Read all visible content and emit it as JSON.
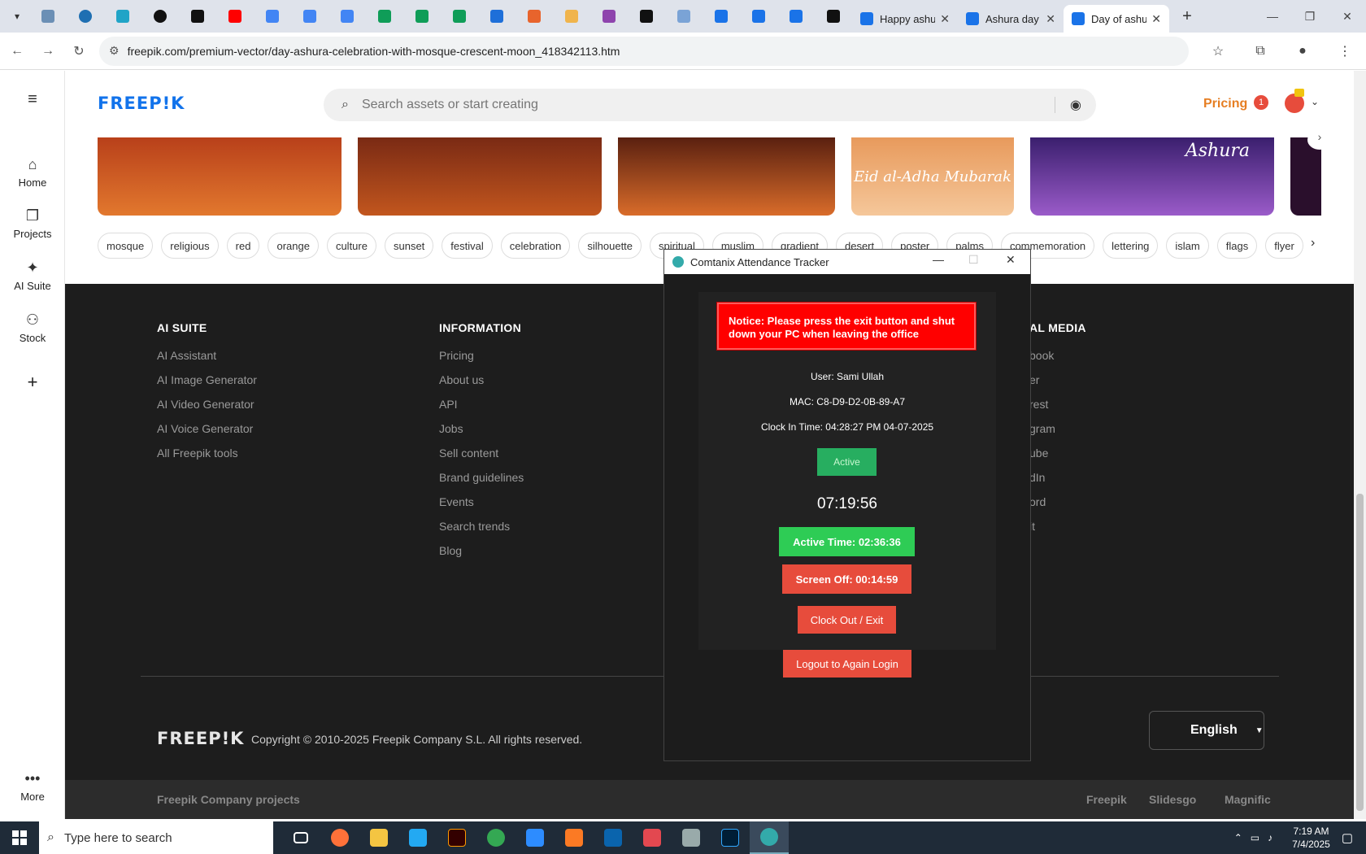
{
  "browser": {
    "tabs": [
      {
        "title": "Happy ashu"
      },
      {
        "title": "Ashura day"
      },
      {
        "title": "Day of ashu"
      }
    ],
    "url": "freepik.com/premium-vector/day-ashura-celebration-with-mosque-crescent-moon_418342113.htm"
  },
  "sidebar": {
    "items": [
      {
        "label": "Home"
      },
      {
        "label": "Projects"
      },
      {
        "label": "AI Suite"
      },
      {
        "label": "Stock"
      }
    ],
    "more_label": "More"
  },
  "header": {
    "logo": "FREEP!K",
    "search_placeholder": "Search assets or start creating",
    "pricing": "Pricing",
    "notification_count": "1"
  },
  "thumbnails": [
    {
      "colors": [
        "#b8401a",
        "#e2782e"
      ]
    },
    {
      "colors": [
        "#7a2a14",
        "#c2561e"
      ]
    },
    {
      "colors": [
        "#5a2010",
        "#d96c2a"
      ],
      "text": ""
    },
    {
      "colors": [
        "#e89a5c",
        "#f5c79a"
      ],
      "text": "Eid al-Adha Mubarak"
    },
    {
      "colors": [
        "#3a1f6e",
        "#9a5bc9"
      ],
      "text": "Ashura"
    }
  ],
  "tags": [
    "mosque",
    "religious",
    "red",
    "orange",
    "culture",
    "sunset",
    "festival",
    "celebration",
    "silhouette",
    "spiritual",
    "muslim",
    "gradient",
    "desert",
    "poster",
    "palms",
    "commemoration",
    "lettering",
    "islam",
    "flags",
    "flyer"
  ],
  "footer": {
    "columns": [
      {
        "title": "AI SUITE",
        "links": [
          "AI Assistant",
          "AI Image Generator",
          "AI Video Generator",
          "AI Voice Generator",
          "All Freepik tools"
        ]
      },
      {
        "title": "INFORMATION",
        "links": [
          "Pricing",
          "About us",
          "API",
          "Jobs",
          "Sell content",
          "Brand guidelines",
          "Events",
          "Search trends",
          "Blog"
        ]
      },
      {
        "title": "AL MEDIA",
        "links": [
          "book",
          "er",
          "rest",
          "gram",
          "ube",
          "dIn",
          "ord",
          "it"
        ]
      }
    ],
    "logo": "FREEP!K",
    "copyright": "Copyright © 2010-2025 Freepik Company S.L. All rights reserved.",
    "language": "English",
    "company_projects": "Freepik Company projects",
    "projects": [
      "Freepik",
      "Slidesgo",
      "Magnific"
    ]
  },
  "dialog": {
    "title": "Comtanix Attendance Tracker",
    "notice": "Notice: Please press the exit button and shut down your PC when leaving the office",
    "user": "User: Sami Ullah",
    "mac": "MAC: C8-D9-D2-0B-89-A7",
    "clock_in": "Clock In Time: 04:28:27 PM 04-07-2025",
    "status": "Active",
    "clock": "07:19:56",
    "active_time": "Active Time: 02:36:36",
    "screen_off": "Screen Off: 00:14:59",
    "clock_out": "Clock Out / Exit",
    "logout": "Logout to Again Login"
  },
  "taskbar": {
    "search_placeholder": "Type here to search",
    "time": "7:19 AM",
    "date": "7/4/2025"
  }
}
